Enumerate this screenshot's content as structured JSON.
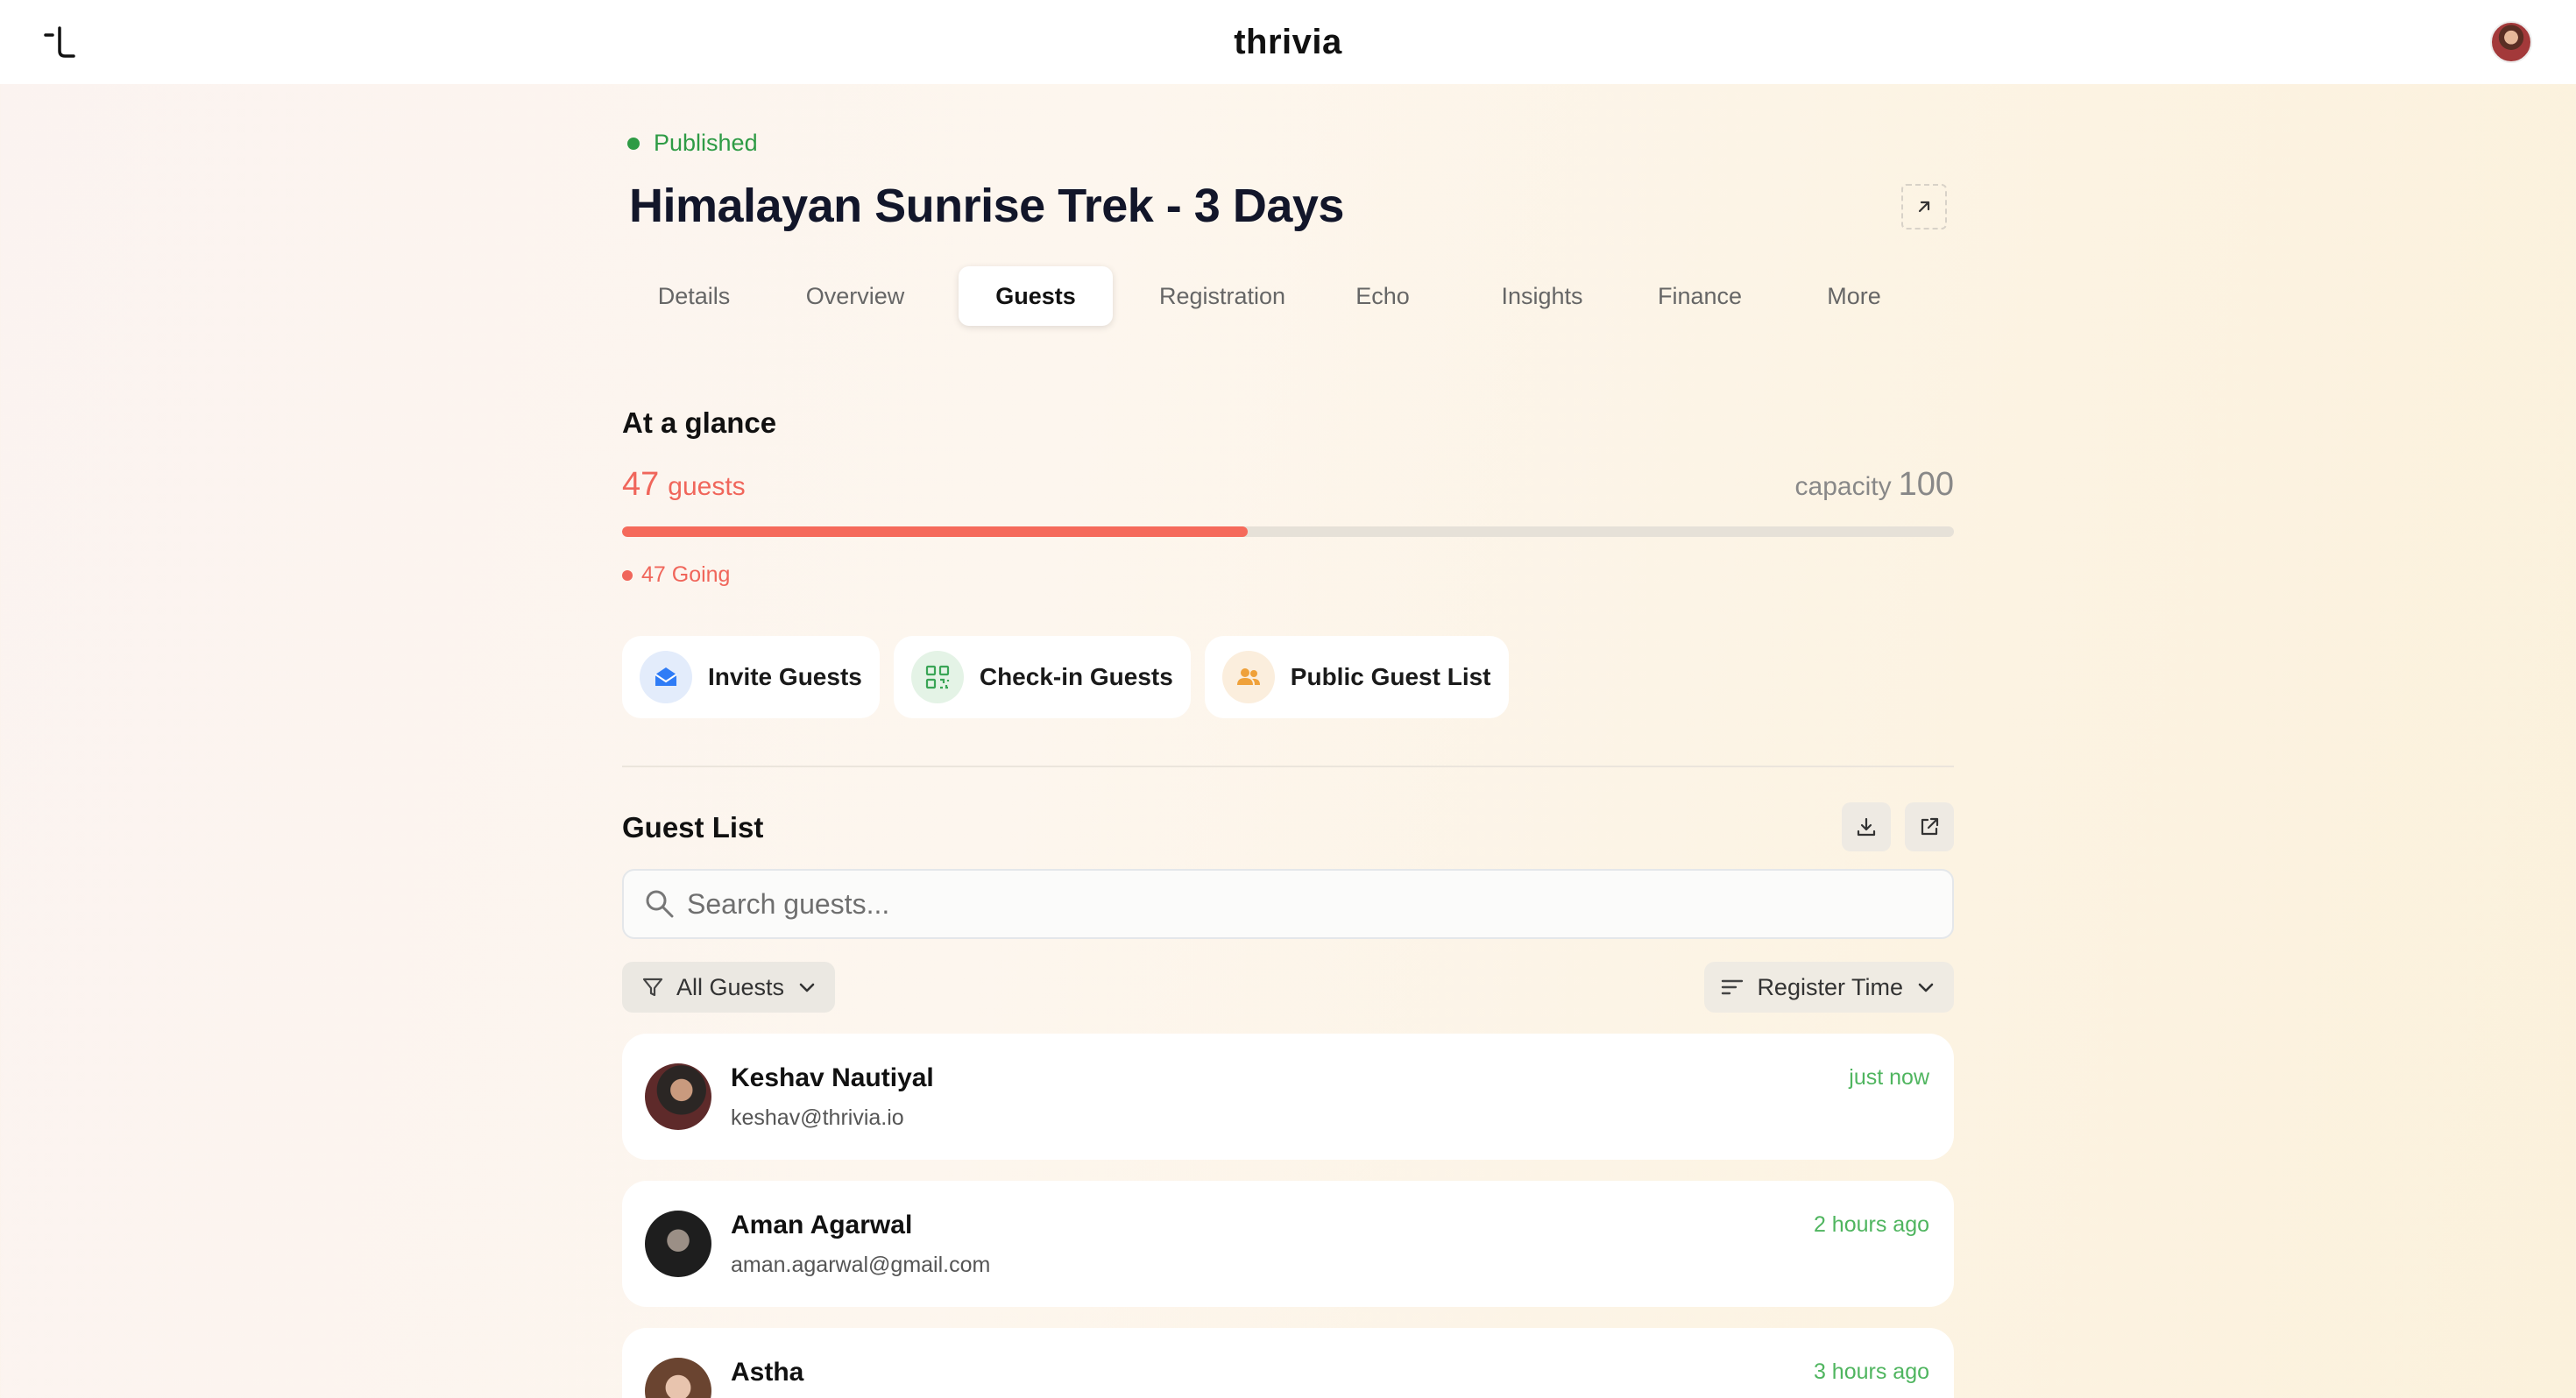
{
  "brand": "thrivia",
  "event": {
    "status": "Published",
    "title": "Himalayan Sunrise Trek - 3 Days"
  },
  "tabs": [
    {
      "label": "Details"
    },
    {
      "label": "Overview"
    },
    {
      "label": "Guests",
      "active": true
    },
    {
      "label": "Registration"
    },
    {
      "label": "Echo"
    },
    {
      "label": "Insights"
    },
    {
      "label": "Finance"
    },
    {
      "label": "More"
    }
  ],
  "glance": {
    "heading": "At a glance",
    "guests_count": "47",
    "guests_label": "guests",
    "capacity_label": "capacity",
    "capacity_value": "100",
    "fill_fraction": 0.47,
    "going_text": "47 Going"
  },
  "actions": [
    {
      "label": "Invite Guests",
      "icon": "envelope-icon",
      "color": "#2f7cf6"
    },
    {
      "label": "Check-in Guests",
      "icon": "qr-code-icon",
      "color": "#3aa556"
    },
    {
      "label": "Public Guest List",
      "icon": "people-icon",
      "color": "#efa13a"
    }
  ],
  "guest_list": {
    "heading": "Guest List",
    "search_placeholder": "Search guests...",
    "filter_label": "All Guests",
    "sort_label": "Register Time",
    "guests": [
      {
        "name": "Keshav Nautiyal",
        "email": "keshav@thrivia.io",
        "time": "just now"
      },
      {
        "name": "Aman Agarwal",
        "email": "aman.agarwal@gmail.com",
        "time": "2 hours ago"
      },
      {
        "name": "Astha",
        "email": "",
        "time": "3 hours ago"
      }
    ]
  },
  "colors": {
    "accent": "#f0665b",
    "published": "#2e9b45",
    "time": "#4fb55f"
  }
}
